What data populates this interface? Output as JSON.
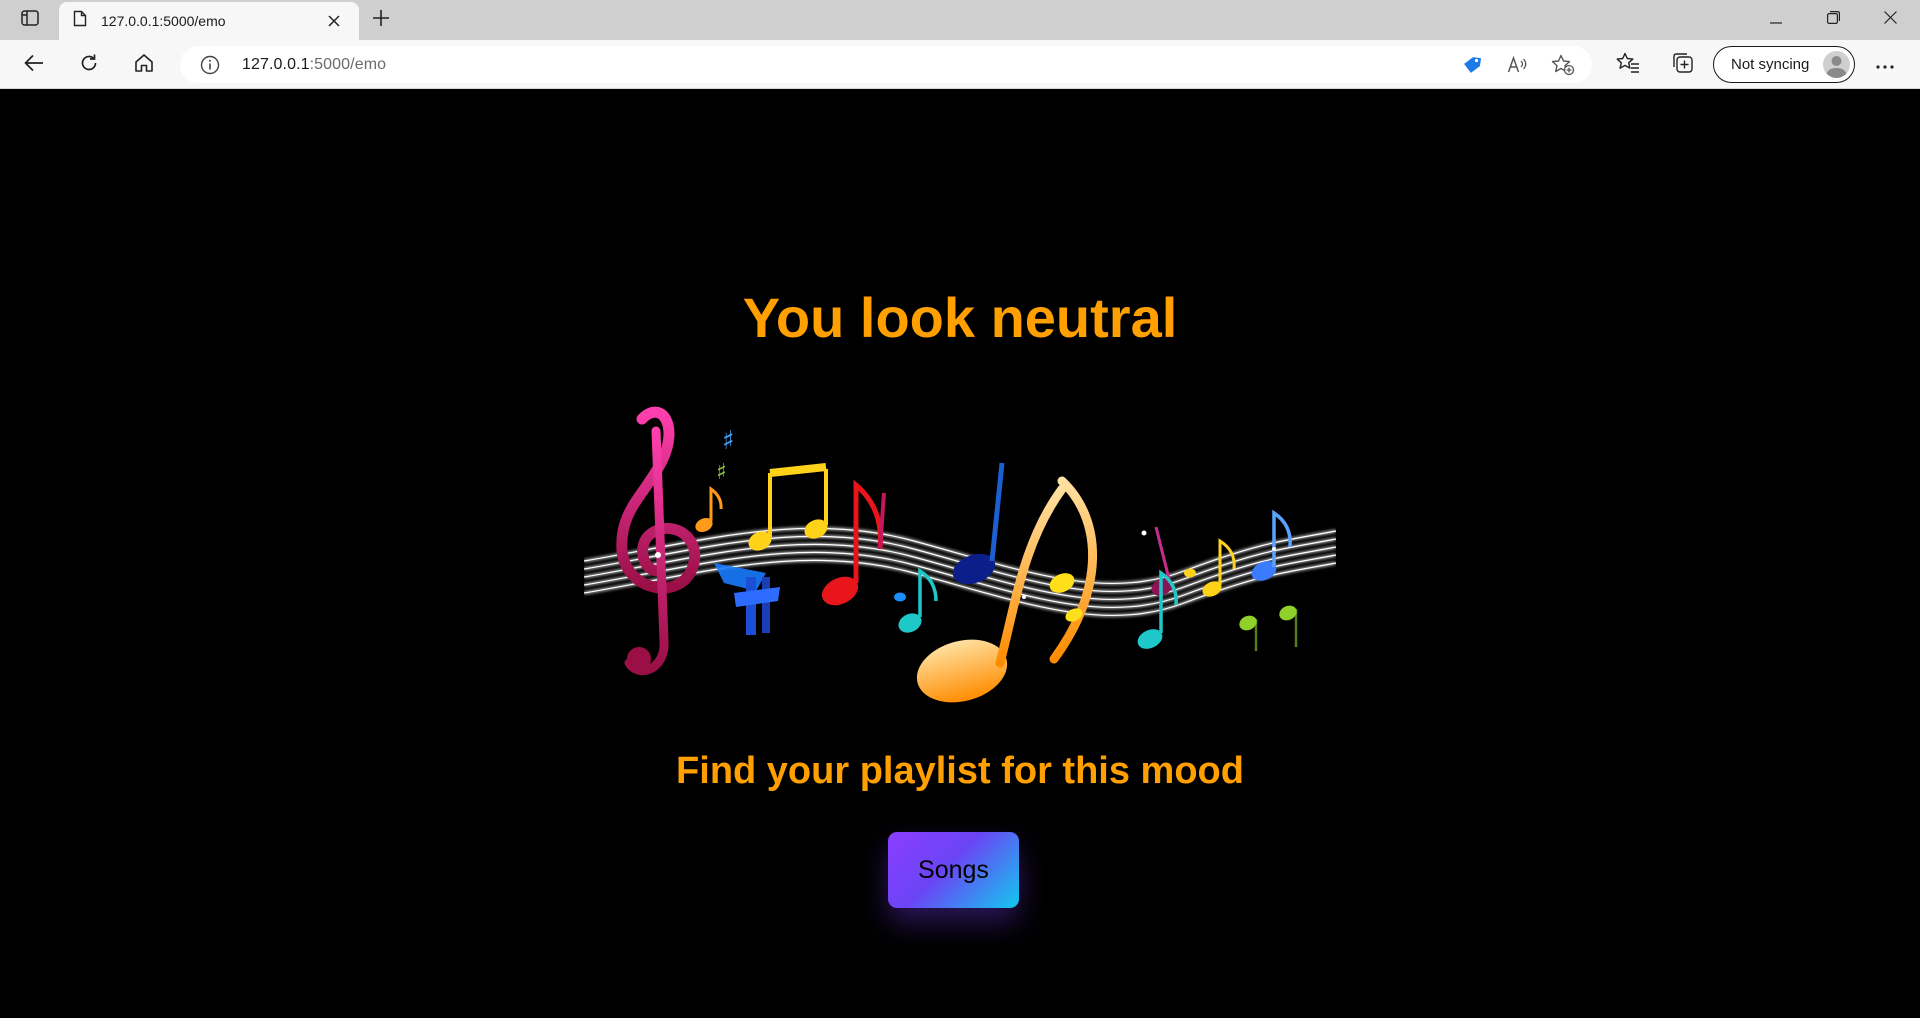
{
  "browser": {
    "tab_title": "127.0.0.1:5000/emo",
    "url_host": "127.0.0.1",
    "url_rest": ":5000/emo",
    "sync_label": "Not syncing",
    "icons": [
      "sidebar-icon",
      "page-icon",
      "close-icon",
      "plus-icon",
      "minimize-icon",
      "restore-icon",
      "window-close-icon",
      "back-icon",
      "refresh-icon",
      "home-icon",
      "info-icon",
      "shopping-tag-icon",
      "read-aloud-icon",
      "add-favorite-icon",
      "favorites-icon",
      "collections-icon",
      "avatar-icon",
      "more-icon"
    ]
  },
  "page": {
    "heading": "You look neutral",
    "subheading": "Find your playlist for this mood",
    "songs_button": "Songs",
    "accent_color": "#ff9f00",
    "background_color": "#000000"
  }
}
